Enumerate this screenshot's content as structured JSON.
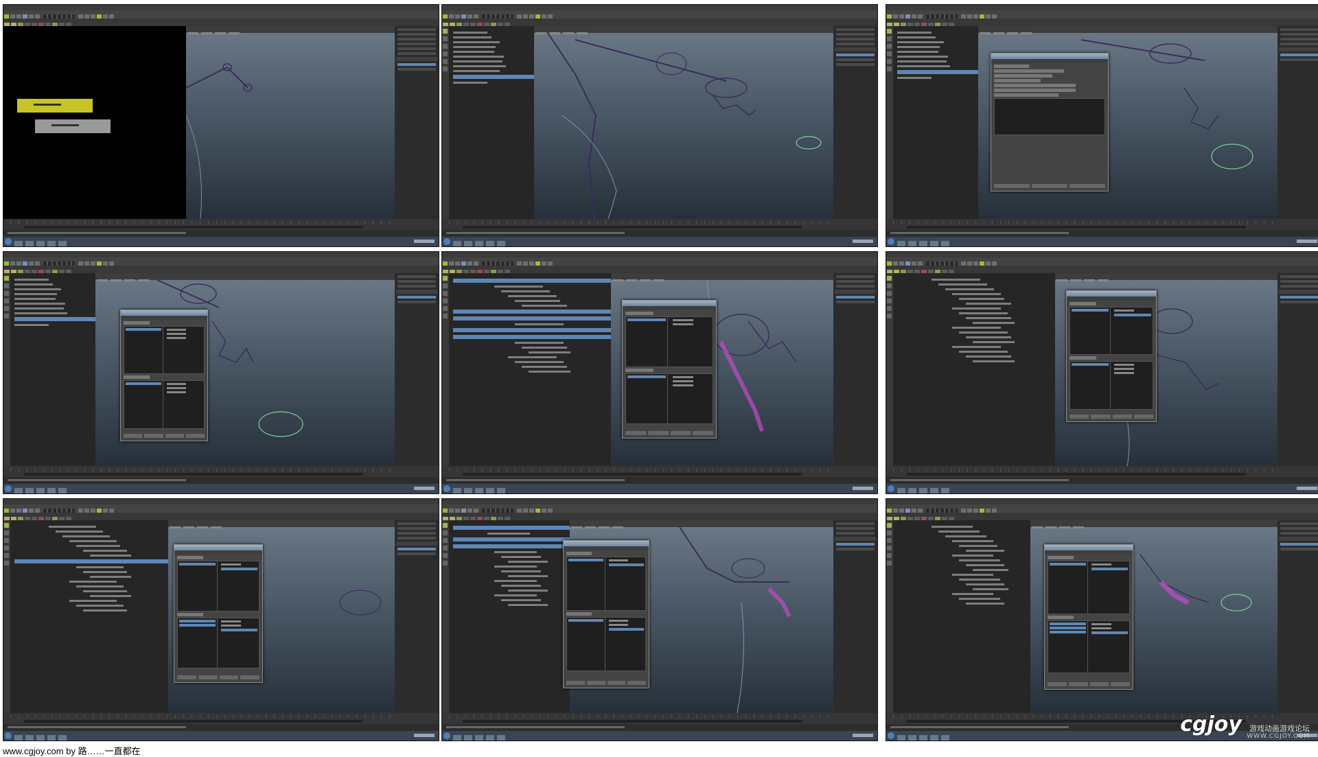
{
  "footer": {
    "credit": "www.cgjoy.com by 路……一直都在"
  },
  "watermark": {
    "logo": "cgjoy",
    "tagline": "游戏动画游戏论坛",
    "url": "WWW.CGJOY.COM"
  },
  "colors": {
    "maya_bg": "#2a2a2a",
    "viewport_top": "#6c7a88",
    "viewport_bottom": "#26303a",
    "selection_blue": "#5f87b5",
    "node_yellow": "#c7c425",
    "node_gray": "#9a9a9a",
    "rig_purple": "#3b2d5c",
    "weight_magenta": "#c04ac8",
    "control_green": "#7fcf9a"
  },
  "icons": [
    "windows-start-icon",
    "maya-shelf-icon",
    "move-tool-icon",
    "rotate-tool-icon",
    "scale-tool-icon"
  ]
}
